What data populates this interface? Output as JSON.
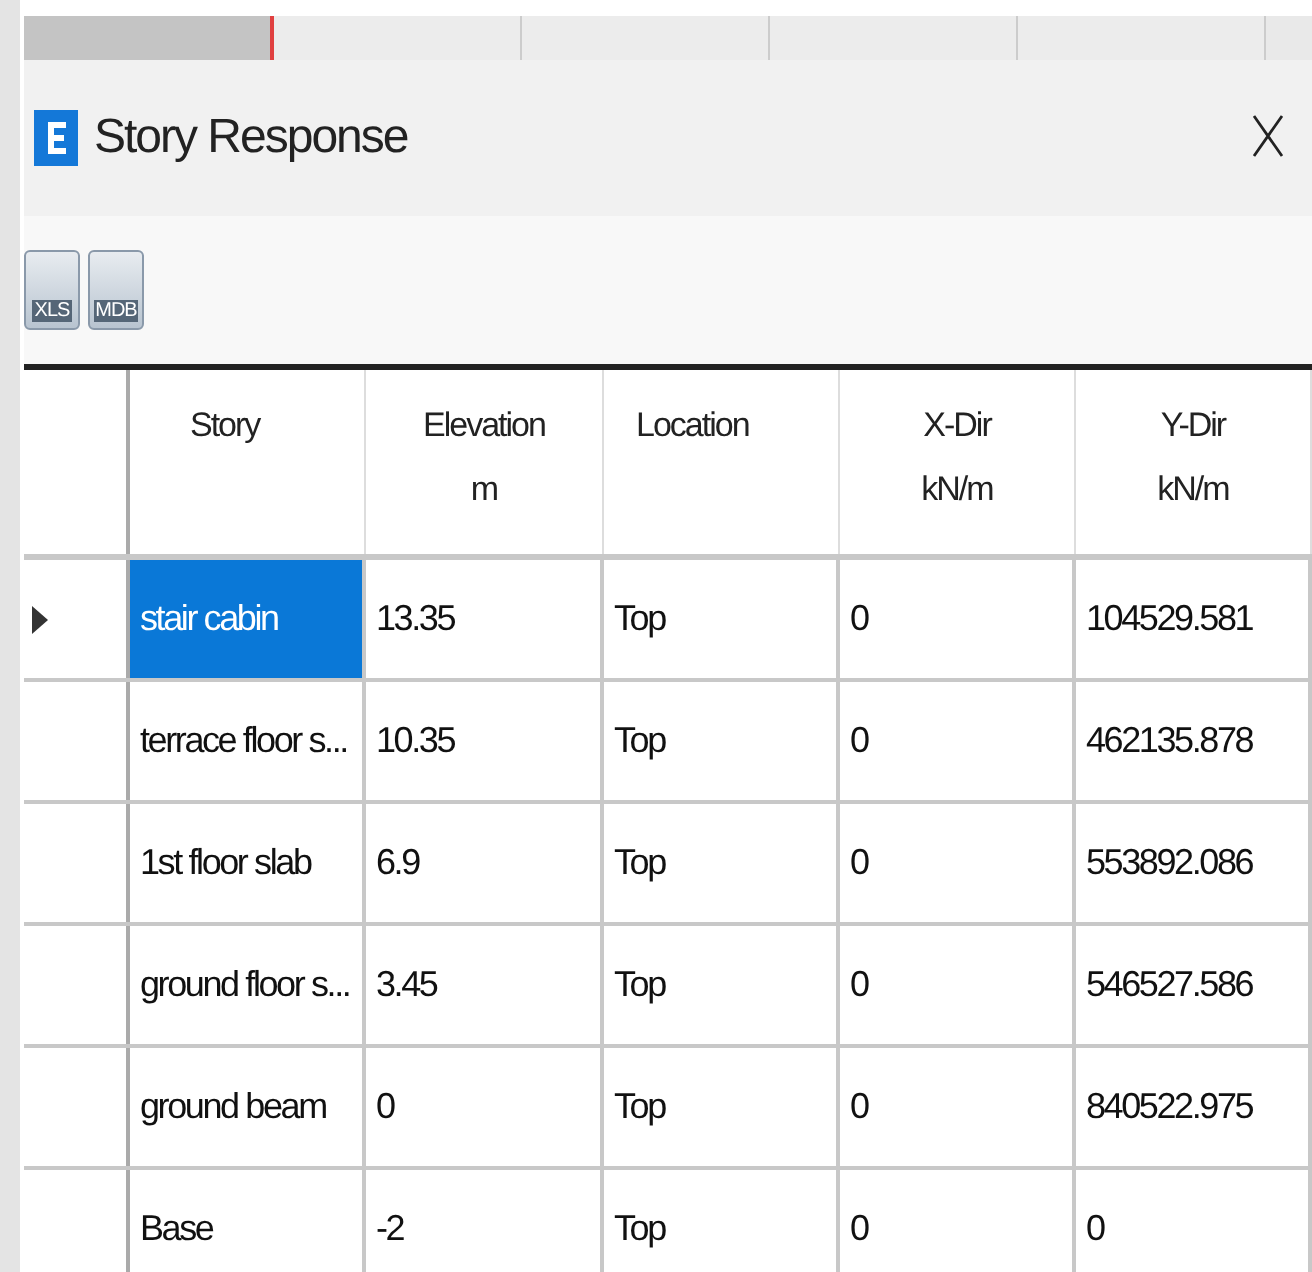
{
  "window": {
    "title": "Story Response"
  },
  "toolbar": {
    "buttons": [
      {
        "label": "XLS"
      },
      {
        "label": "MDB"
      }
    ]
  },
  "table": {
    "columns": [
      {
        "title": "Story"
      },
      {
        "title": "Elevation",
        "unit": "m"
      },
      {
        "title": "Location"
      },
      {
        "title": "X-Dir",
        "unit": "kN/m"
      },
      {
        "title": "Y-Dir",
        "unit": "kN/m"
      }
    ],
    "rows": [
      {
        "selected": true,
        "cells": [
          "stair cabin",
          "13.35",
          "Top",
          "0",
          "104529.581"
        ]
      },
      {
        "selected": false,
        "cells": [
          "terrace floor s...",
          "10.35",
          "Top",
          "0",
          "462135.878"
        ]
      },
      {
        "selected": false,
        "cells": [
          "1st floor slab",
          "6.9",
          "Top",
          "0",
          "553892.086"
        ]
      },
      {
        "selected": false,
        "cells": [
          "ground floor s...",
          "3.45",
          "Top",
          "0",
          "546527.586"
        ]
      },
      {
        "selected": false,
        "cells": [
          "ground beam",
          "0",
          "Top",
          "0",
          "840522.975"
        ]
      },
      {
        "selected": false,
        "cells": [
          "Base",
          "-2",
          "Top",
          "0",
          "0"
        ]
      }
    ]
  }
}
